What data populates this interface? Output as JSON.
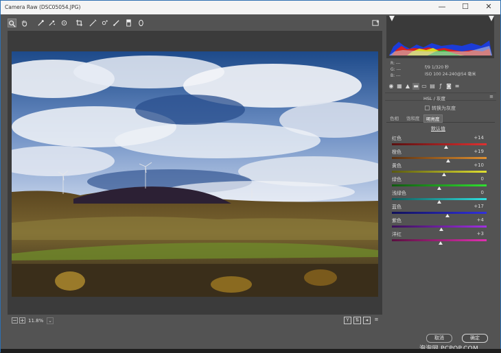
{
  "window": {
    "title": "Camera Raw (DSC05054.JPG)",
    "min": "—",
    "max": "☐",
    "close": "✕"
  },
  "toolbar": {
    "tools": [
      "zoom-tool",
      "hand-tool",
      "white-balance-tool",
      "color-sampler-tool",
      "targeted-adjustment-tool",
      "crop-tool",
      "straighten-tool",
      "spot-removal-tool",
      "redeye-tool",
      "adjustment-brush-tool",
      "graduated-filter-tool",
      "radial-filter-tool"
    ],
    "fullscreen_icon": "fullscreen-icon"
  },
  "zoom": {
    "value": "11.8%",
    "dropdown": "⌄"
  },
  "view_buttons": {
    "y": "Y",
    "before_after": "⇅",
    "swap": "◂",
    "settings": "≡"
  },
  "readout": {
    "r": "R:   ---",
    "g": "G:   ---",
    "b": "B:   ---",
    "exif1": "f/9    1/320 秒",
    "exif2": "ISO 100    24-240@54 毫米"
  },
  "panel": {
    "title": "HSL / 灰度",
    "grayscale_label": "转换为灰度",
    "subtabs": [
      "色相",
      "饱和度",
      "明亮度"
    ],
    "active_subtab": "明亮度",
    "defaults_link": "默认值",
    "sliders": [
      {
        "label": "红色",
        "value": "+14",
        "level": 14
      },
      {
        "label": "橙色",
        "value": "+19",
        "level": 19
      },
      {
        "label": "黄色",
        "value": "+10",
        "level": 10
      },
      {
        "label": "绿色",
        "value": "0",
        "level": 0
      },
      {
        "label": "浅绿色",
        "value": "0",
        "level": 0
      },
      {
        "label": "蓝色",
        "value": "+17",
        "level": 17
      },
      {
        "label": "紫色",
        "value": "+4",
        "level": 4
      },
      {
        "label": "洋红",
        "value": "+3",
        "level": 3
      }
    ]
  },
  "buttons": {
    "cancel": "取消",
    "ok": "确定"
  },
  "watermark": "泡泡网 PCPOP.COM",
  "colors": {
    "accent": "#2d6fb1",
    "bg": "#535353",
    "canvas": "#3b3b3b"
  }
}
